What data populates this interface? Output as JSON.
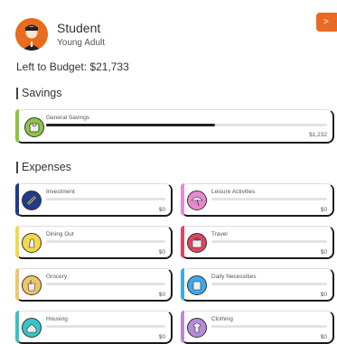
{
  "profile": {
    "name": "Student",
    "subtitle": "Young Adult"
  },
  "next_button": {
    "label": ">"
  },
  "budget": {
    "text": "Left to Budget: $21,733"
  },
  "savings": {
    "title": "Savings",
    "items": [
      {
        "label": "General Savings",
        "amount": "$1,232",
        "fill": 0.6,
        "color": "#8cc63e",
        "icon": "toilet-paper-icon"
      }
    ]
  },
  "expenses": {
    "title": "Expenses",
    "items": [
      {
        "label": "Investment",
        "amount": "$0",
        "fill": 0,
        "color": "#1f3a8a",
        "icon": "investment-icon"
      },
      {
        "label": "Leisure Activities",
        "amount": "$0",
        "fill": 0,
        "color": "#e88ad0",
        "icon": "beach-umbrella-icon"
      },
      {
        "label": "Dining Out",
        "amount": "$0",
        "fill": 0,
        "color": "#f0d94a",
        "icon": "dining-icon"
      },
      {
        "label": "Travel",
        "amount": "$0",
        "fill": 0,
        "color": "#e0445f",
        "icon": "suitcase-icon"
      },
      {
        "label": "Grocery",
        "amount": "$0",
        "fill": 0,
        "color": "#f2c469",
        "icon": "grocery-bag-icon"
      },
      {
        "label": "Daily Necessities",
        "amount": "$0",
        "fill": 0,
        "color": "#3ea9e8",
        "icon": "daily-necessities-icon"
      },
      {
        "label": "Housing",
        "amount": "$0",
        "fill": 0,
        "color": "#39c3c4",
        "icon": "house-icon"
      },
      {
        "label": "Clothing",
        "amount": "$0",
        "fill": 0,
        "color": "#b58ad9",
        "icon": "shirt-icon"
      }
    ]
  }
}
